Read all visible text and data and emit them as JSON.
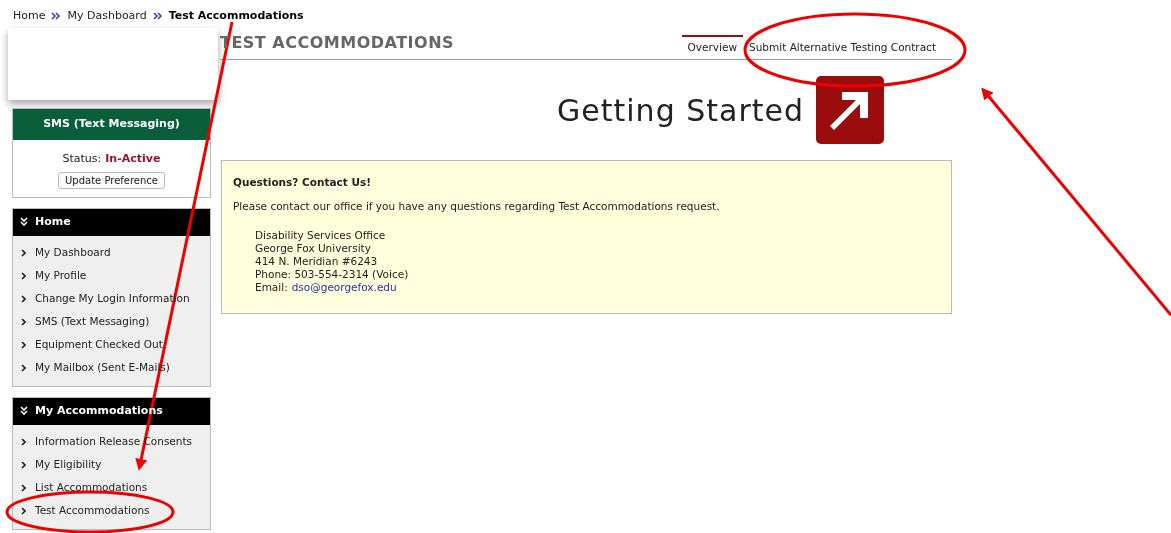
{
  "breadcrumb": [
    {
      "label": "Home",
      "current": false
    },
    {
      "label": "My Dashboard",
      "current": false
    },
    {
      "label": "Test Accommodations",
      "current": true
    }
  ],
  "sms_panel": {
    "title": "SMS (Text Messaging)",
    "status_label": "Status:",
    "status_value": "In-Active",
    "button": "Update Preference"
  },
  "menus": [
    {
      "title": "Home",
      "items": [
        {
          "label": "My Dashboard"
        },
        {
          "label": "My Profile"
        },
        {
          "label": "Change My Login Information"
        },
        {
          "label": "SMS (Text Messaging)"
        },
        {
          "label": "Equipment Checked Out"
        },
        {
          "label": "My Mailbox (Sent E-Mails)"
        }
      ]
    },
    {
      "title": "My Accommodations",
      "items": [
        {
          "label": "Information Release Consents"
        },
        {
          "label": "My Eligibility"
        },
        {
          "label": "List Accommodations"
        },
        {
          "label": "Test Accommodations"
        }
      ]
    }
  ],
  "page_title": "TEST ACCOMMODATIONS",
  "tabs": [
    {
      "label": "Overview",
      "selected": true
    },
    {
      "label": "Submit Alternative Testing Contract",
      "selected": false
    }
  ],
  "banner": {
    "title": "Getting Started"
  },
  "contact": {
    "heading": "Questions? Contact Us!",
    "intro": "Please contact our office if you have any questions regarding Test Accommodations request.",
    "address": [
      "Disability Services Office",
      "George Fox University",
      "414 N. Meridian #6243",
      "Phone: 503-554-2314 (Voice)"
    ],
    "email_label": "Email:",
    "email": "dso@georgefox.edu"
  }
}
